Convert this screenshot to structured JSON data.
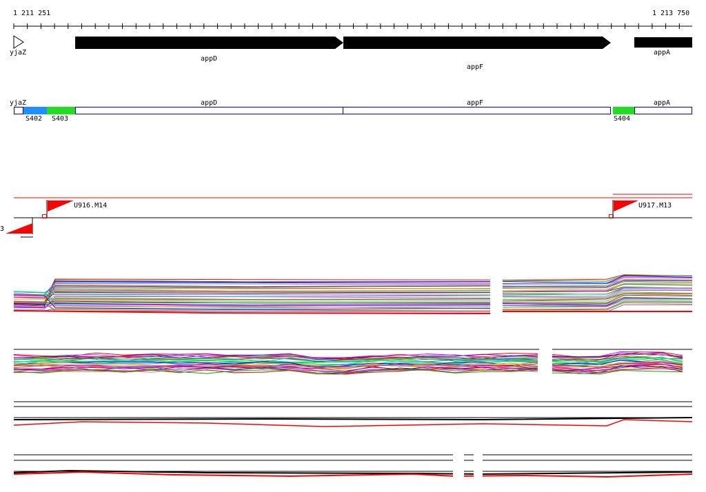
{
  "ruler": {
    "start_label": "1 211 251",
    "end_label": "1 213 750"
  },
  "genes": [
    {
      "id": "yjaZ",
      "label": "yjaZ"
    },
    {
      "id": "appD",
      "label": "appD"
    },
    {
      "id": "appF",
      "label": "appF"
    },
    {
      "id": "appA",
      "label": "appA"
    }
  ],
  "segments": [
    {
      "id": "yjaZ",
      "label": "yjaZ",
      "color": "#ffffff"
    },
    {
      "id": "S402",
      "label": "S402",
      "color": "#1e90ff"
    },
    {
      "id": "S403",
      "label": "S403",
      "color": "#22dd22"
    },
    {
      "id": "appD",
      "label": "appD",
      "color": "#ffffff"
    },
    {
      "id": "appF",
      "label": "appF",
      "color": "#ffffff"
    },
    {
      "id": "S404",
      "label": "S404",
      "color": "#22dd22"
    },
    {
      "id": "appA",
      "label": "appA",
      "color": "#ffffff"
    }
  ],
  "features": [
    {
      "id": "U916",
      "label": "U916.M14"
    },
    {
      "id": "U917",
      "label": "U917.M13"
    },
    {
      "id": "left-partial",
      "label": "3"
    }
  ],
  "colors": {
    "outline_blue": "#0000cc",
    "flag_red": "#ff0000",
    "gene_arrow": "#000000"
  }
}
